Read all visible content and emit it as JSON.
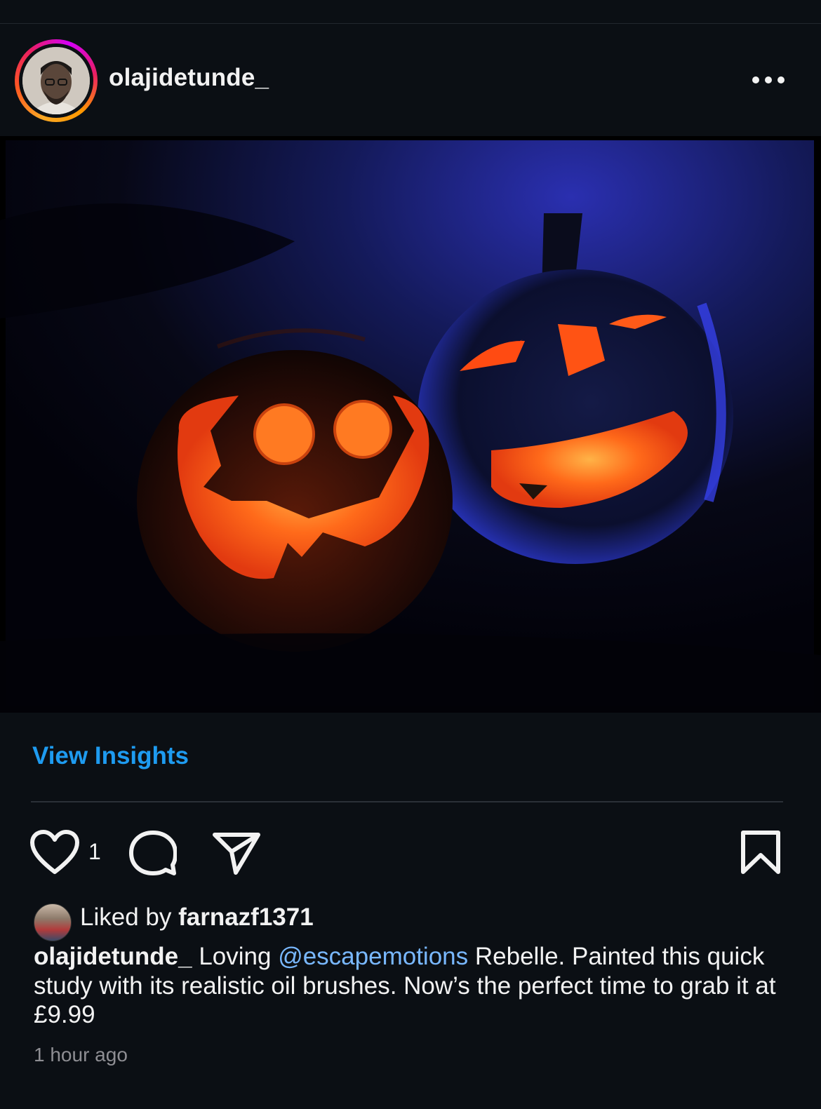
{
  "post": {
    "username": "olajidetunde_",
    "more_icon": "more-horizontal-icon",
    "image_alt": "Painting of two glowing jack-o'-lanterns"
  },
  "insights": {
    "label": "View Insights",
    "color": "#1e9bf0"
  },
  "actions": {
    "like_icon": "heart-icon",
    "like_count": "1",
    "comment_icon": "comment-icon",
    "share_icon": "send-icon",
    "save_icon": "bookmark-icon"
  },
  "likes": {
    "prefix": "Liked by ",
    "user": "farnazf1371"
  },
  "caption": {
    "user": "olajidetunde_",
    "text_before": " Loving ",
    "mention": "@escapemotions",
    "text_after": " Rebelle. Painted this quick study with its realistic oil brushes. Now’s the perfect time to grab it at £9.99",
    "mention_color": "#79b8ff"
  },
  "timestamp": "1 hour ago"
}
